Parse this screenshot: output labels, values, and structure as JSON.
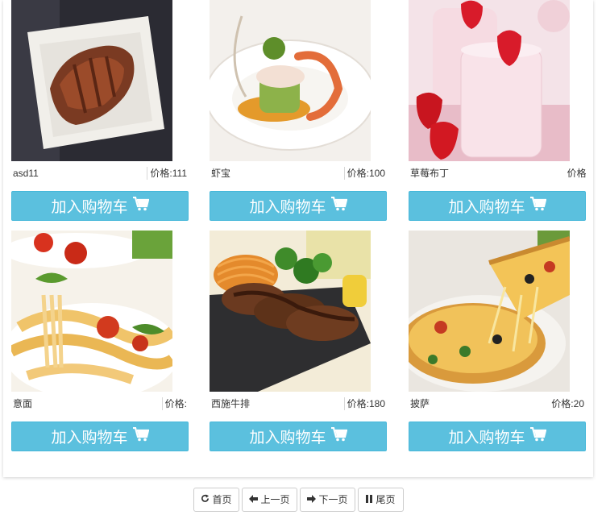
{
  "products": [
    {
      "name": "asd11",
      "price_label": "价格:",
      "price": "111",
      "button": "加入购物车",
      "image": "roast-meat"
    },
    {
      "name": "虾宝",
      "price_label": "价格:",
      "price": "100",
      "button": "加入购物车",
      "image": "shrimp-dish"
    },
    {
      "name": "草莓布丁",
      "price_label": "价格:",
      "price": "",
      "button": "加入购物车",
      "image": "strawberry-pudding"
    },
    {
      "name": "意面",
      "price_label": "价格:",
      "price": "",
      "button": "加入购物车",
      "image": "pasta"
    },
    {
      "name": "西施牛排",
      "price_label": "价格:",
      "price": "180",
      "button": "加入购物车",
      "image": "steak"
    },
    {
      "name": "披萨",
      "price_label": "价格:",
      "price": "20",
      "button": "加入购物车",
      "image": "pizza"
    }
  ],
  "pagination": {
    "first": "首页",
    "prev": "上一页",
    "next": "下一页",
    "last": "尾页"
  },
  "colors": {
    "button": "#5bc0de",
    "button_border": "#46b8da"
  }
}
